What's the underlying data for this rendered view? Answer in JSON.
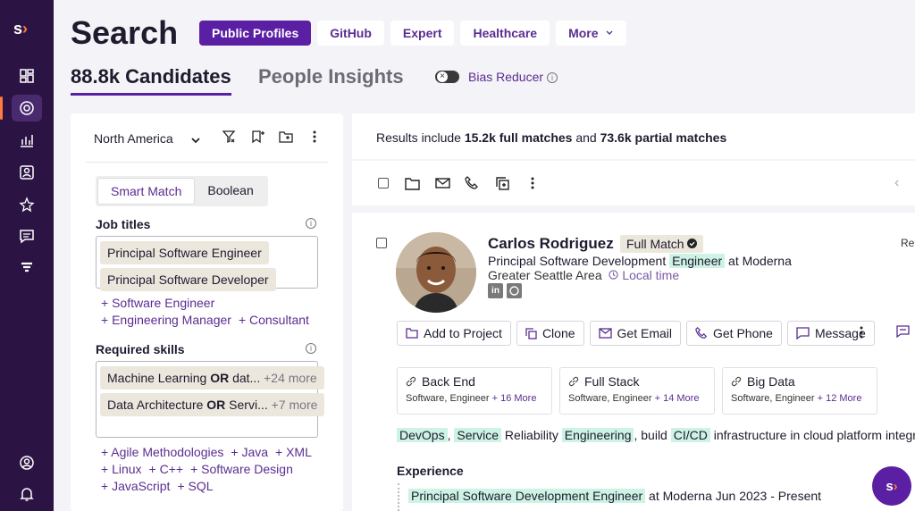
{
  "rail": {
    "logo_s": "s",
    "logo_chev": "›",
    "icons": [
      "dashboard-icon",
      "search-icon",
      "insights-icon",
      "contacts-icon",
      "star-icon",
      "messages-icon",
      "filter-icon",
      "user-icon",
      "bell-icon"
    ],
    "active_index": 1
  },
  "header": {
    "title": "Search",
    "tabs": [
      {
        "label": "Public Profiles",
        "active": true
      },
      {
        "label": "GitHub",
        "active": false
      },
      {
        "label": "Expert",
        "active": false
      },
      {
        "label": "Healthcare",
        "active": false
      },
      {
        "label": "More",
        "active": false
      }
    ],
    "candidates_tab": "88.8k Candidates",
    "insights_tab": "People Insights",
    "bias_reducer": "Bias Reducer",
    "info_glyph": "i"
  },
  "filters": {
    "region": "North America",
    "mode_options": [
      "Smart Match",
      "Boolean"
    ],
    "job_titles_label": "Job titles",
    "job_titles": [
      "Principal Software Engineer",
      "Principal Software Developer"
    ],
    "job_title_suggestions": [
      "+ Software Engineer",
      "+ Engineering Manager",
      "+ Consultant"
    ],
    "skills_label": "Required skills",
    "skills_chips": [
      {
        "a": "Machine Learning ",
        "op": "OR",
        "b": " dat...",
        "more": "+24 more"
      },
      {
        "a": "Data Architecture ",
        "op": "OR",
        "b": " Servi...",
        "more": "+7 more"
      }
    ],
    "skill_suggestions_1": [
      "+ Agile Methodologies",
      "+ Java",
      "+ XML"
    ],
    "skill_suggestions_2": [
      "+ Linux",
      "+ C++",
      "+ Software Design"
    ],
    "skill_suggestions_3": [
      "+ JavaScript",
      "+ SQL"
    ]
  },
  "results": {
    "prefix": "Results include ",
    "full": "15.2k full matches",
    "mid": " and ",
    "partial": "73.6k partial matches"
  },
  "candidate": {
    "name": "Carlos Rodriguez",
    "badge": "Full Match",
    "role_pre": "Principal Software Development ",
    "role_hl": "Engineer",
    "role_post": " at Moderna",
    "location": "Greater Seattle Area",
    "local_time": "Local time",
    "socials": [
      "in",
      "gh"
    ],
    "rep": "Rep",
    "actions": [
      {
        "label": "Add to Project",
        "icon": "folder-icon"
      },
      {
        "label": "Clone",
        "icon": "clone-icon"
      },
      {
        "label": "Get Email",
        "icon": "email-icon"
      },
      {
        "label": "Get Phone",
        "icon": "phone-icon"
      },
      {
        "label": "Message",
        "icon": "message-icon"
      }
    ],
    "skills": [
      {
        "title": "Back End",
        "sub": "Software, Engineer",
        "more": "+ 16 More"
      },
      {
        "title": "Full Stack",
        "sub": "Software, Engineer",
        "more": "+ 14 More"
      },
      {
        "title": "Big Data",
        "sub": "Software, Engineer",
        "more": "+ 12 More"
      }
    ],
    "summary": [
      {
        "t": "DevOps",
        "hl": true
      },
      {
        "t": ", ",
        "hl": false
      },
      {
        "t": "Service",
        "hl": true
      },
      {
        "t": " Reliability ",
        "hl": false
      },
      {
        "t": "Engineering",
        "hl": true
      },
      {
        "t": ", build ",
        "hl": false
      },
      {
        "t": "CI/CD",
        "hl": true
      },
      {
        "t": " infrastructure in cloud platform integrat",
        "hl": false
      }
    ],
    "experience_label": "Experience",
    "experience_title": "Principal Software Development Engineer",
    "experience_rest": " at Moderna Jun 2023 - Present"
  },
  "fab": {
    "s": "s",
    "chev": "›"
  }
}
